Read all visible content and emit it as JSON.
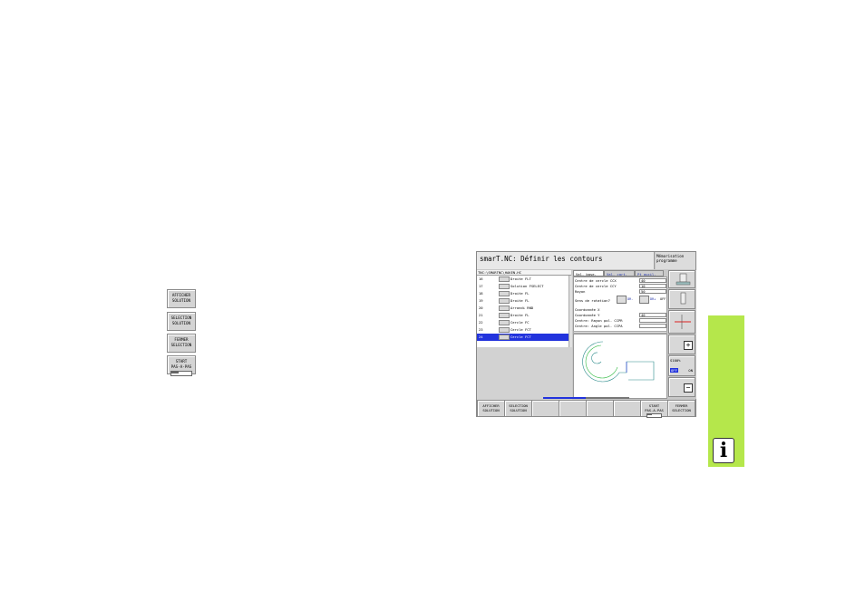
{
  "margin_buttons": [
    {
      "line1": "AFFICHER",
      "line2": "SOLUTION"
    },
    {
      "line1": "SELECTION",
      "line2": "SOLUTION"
    },
    {
      "line1": "FERMER",
      "line2": "SELECTION"
    },
    {
      "line1": "START",
      "line2": "PAS-A-PAS"
    }
  ],
  "screen": {
    "title": "smarT.NC: Définir les contours",
    "mode_line1": "Mémorisation",
    "mode_line2": "programme",
    "path": "TNC:\\SMARTNC\\HAKEN.HC",
    "program_rows": [
      {
        "num": "16",
        "text": "Droite FLT"
      },
      {
        "num": "17",
        "text": "Solution FSELECT"
      },
      {
        "num": "18",
        "text": "Droite FL"
      },
      {
        "num": "19",
        "text": "Droite FL"
      },
      {
        "num": "20",
        "text": "Arrondi RND"
      },
      {
        "num": "21",
        "text": "Droite FL"
      },
      {
        "num": "22",
        "text": "Cercle FC"
      },
      {
        "num": "23",
        "text": "Cercle FCT"
      },
      {
        "num": "24",
        "text": "Cercle FCT"
      }
    ],
    "selected_row": 8,
    "tabs": [
      "Val. base.",
      "Val. cart.",
      "Pt auxil."
    ],
    "form_rows": [
      {
        "label": "Centre de cercle CCX",
        "value": "40"
      },
      {
        "label": "Centre de cercle CCY",
        "value": "10"
      },
      {
        "label": "Rayon",
        "value": "50"
      }
    ],
    "rotation_label": "Sens de rotation?",
    "rotation_opt1": "DR-",
    "rotation_opt2": "DR+",
    "rotation_off": "OFF",
    "coord_rows": [
      {
        "label": "Coordonnée X",
        "value": ""
      },
      {
        "label": "Coordonnée Y",
        "value": "40"
      },
      {
        "label": "Centre: Rayon pol. CCPR",
        "value": ""
      },
      {
        "label": "Centre: Angle pol. CCPA",
        "value": ""
      }
    ],
    "side_keys": {
      "s100": "S100%",
      "off": "OFF",
      "on": "ON"
    },
    "softkeys": [
      {
        "line1": "AFFICHER",
        "line2": "SOLUTION"
      },
      {
        "line1": "SELECTION",
        "line2": "SOLUTION"
      },
      {
        "line1": "",
        "line2": ""
      },
      {
        "line1": "",
        "line2": ""
      },
      {
        "line1": "",
        "line2": ""
      },
      {
        "line1": "",
        "line2": ""
      },
      {
        "line1": "START",
        "line2": "PAS-A-PAS"
      },
      {
        "line1": "FERMER",
        "line2": "SELECTION"
      }
    ]
  },
  "info_icon": "i",
  "colors": {
    "accent_green": "#b5e74b",
    "selection_blue": "#2233dd"
  }
}
